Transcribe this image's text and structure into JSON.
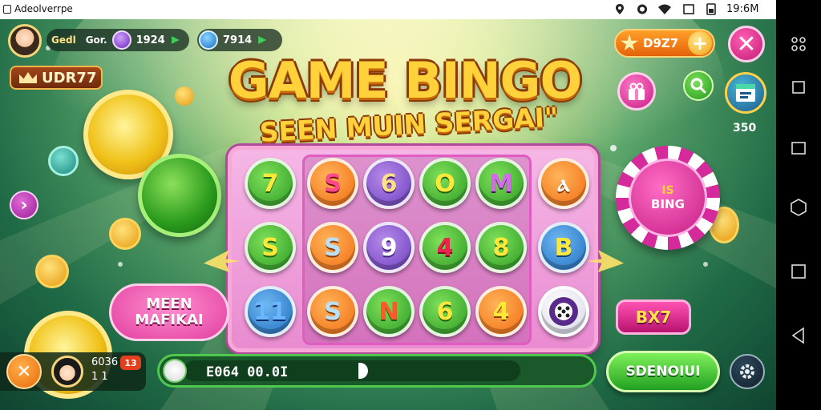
{
  "status_bar": {
    "app_name": "Adeolverrpe",
    "time": "19:6M"
  },
  "hud": {
    "label_a": "Gedl",
    "label_b": "Gor.",
    "value_a": "1924",
    "value_b": "7914",
    "player_tag": "UDR77"
  },
  "title": {
    "main": "GAME BINGO",
    "sub": "SEEN MUIN SERGAI\""
  },
  "board": {
    "side_left": [
      "7",
      "S",
      "11"
    ],
    "grid": [
      [
        "S",
        "6",
        "O",
        "M"
      ],
      [
        "S",
        "9",
        "4",
        "8"
      ],
      [
        "S",
        "N",
        "6",
        "4"
      ]
    ],
    "side_right": [
      "ⲁ",
      "B"
    ]
  },
  "right_panel": {
    "coins": "D9Z7",
    "plus": "+",
    "close": "✕",
    "level": "350",
    "bingo_chip_top": "IS",
    "bingo_chip_label": "BING",
    "bx7": "BX7"
  },
  "menu_bubble": {
    "line1": "MEEN",
    "line2": "MAFIKAI"
  },
  "bottom": {
    "stats_top": "6036",
    "stats_bottom": "1 1",
    "badge": "13",
    "progress_text": "E064 00.0I",
    "start_label": "SDENOIUI"
  },
  "colors": {
    "accent_pink": "#e23e9e",
    "accent_green": "#2b9a23",
    "accent_orange": "#f06a10",
    "title_yellow": "#ffd23c"
  },
  "icons": {
    "avatar": "avatar-icon",
    "settings": "gear-icon",
    "search": "search-icon",
    "arrow": "chevron-right-icon"
  }
}
